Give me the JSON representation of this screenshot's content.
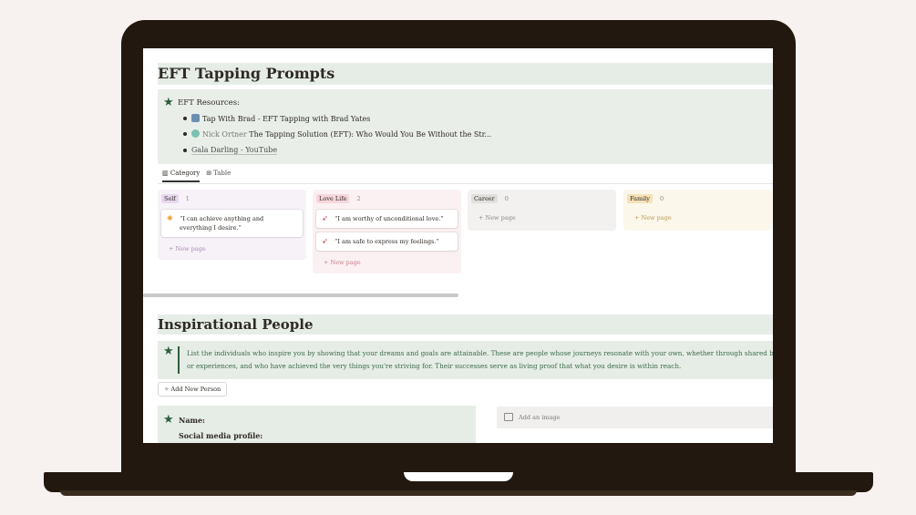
{
  "eft": {
    "title": "EFT Tapping Prompts",
    "resources_title": "EFT Resources:",
    "links": [
      {
        "prefix": "",
        "text": "Tap With Brad - EFT Tapping with Brad Yates"
      },
      {
        "prefix": "Nick Ortner",
        "text": "The Tapping Solution (EFT): Who Would You Be Without the Str..."
      },
      {
        "prefix": "",
        "text": "Gala Darling - YouTube"
      }
    ]
  },
  "views": {
    "category": "Category",
    "table": "Table"
  },
  "columns": [
    {
      "tag": "Self",
      "count": "1",
      "tag_bg": "#e8d8ee",
      "col_bg": "#f7f2f8",
      "newpage_color": "#a98bb4",
      "cards": [
        "“I can achieve anything and everything I desire.”"
      ]
    },
    {
      "tag": "Love Life",
      "count": "2",
      "tag_bg": "#f6d7dd",
      "col_bg": "#fbf1f2",
      "newpage_color": "#c97b8a",
      "cards": [
        "“I am worthy of unconditional love.”",
        "“I am safe to express my feelings.”"
      ]
    },
    {
      "tag": "Career",
      "count": "0",
      "tag_bg": "#e2e0dd",
      "col_bg": "#f2f1ef",
      "newpage_color": "#8a8a8a",
      "cards": []
    },
    {
      "tag": "Family",
      "count": "0",
      "tag_bg": "#f5e2b8",
      "col_bg": "#fbf7ea",
      "newpage_color": "#b89a55",
      "cards": []
    }
  ],
  "new_page_label": "New page",
  "people": {
    "title": "Inspirational People",
    "callout_line1": "List the individuals who inspire you by showing that your dreams and goals are attainable. These are people whose journeys resonate with your own, whether through shared backg",
    "callout_line2": "or experiences, and who have achieved the very things you're striving for. Their successes serve as living proof that what you desire is within reach.",
    "add_button": "Add New Person",
    "name_label": "Name:",
    "social_label": "Social media profile:",
    "add_image": "Add an image"
  },
  "colors": {
    "accent_green": "#2f5e3e",
    "laptop": "#22180f"
  }
}
